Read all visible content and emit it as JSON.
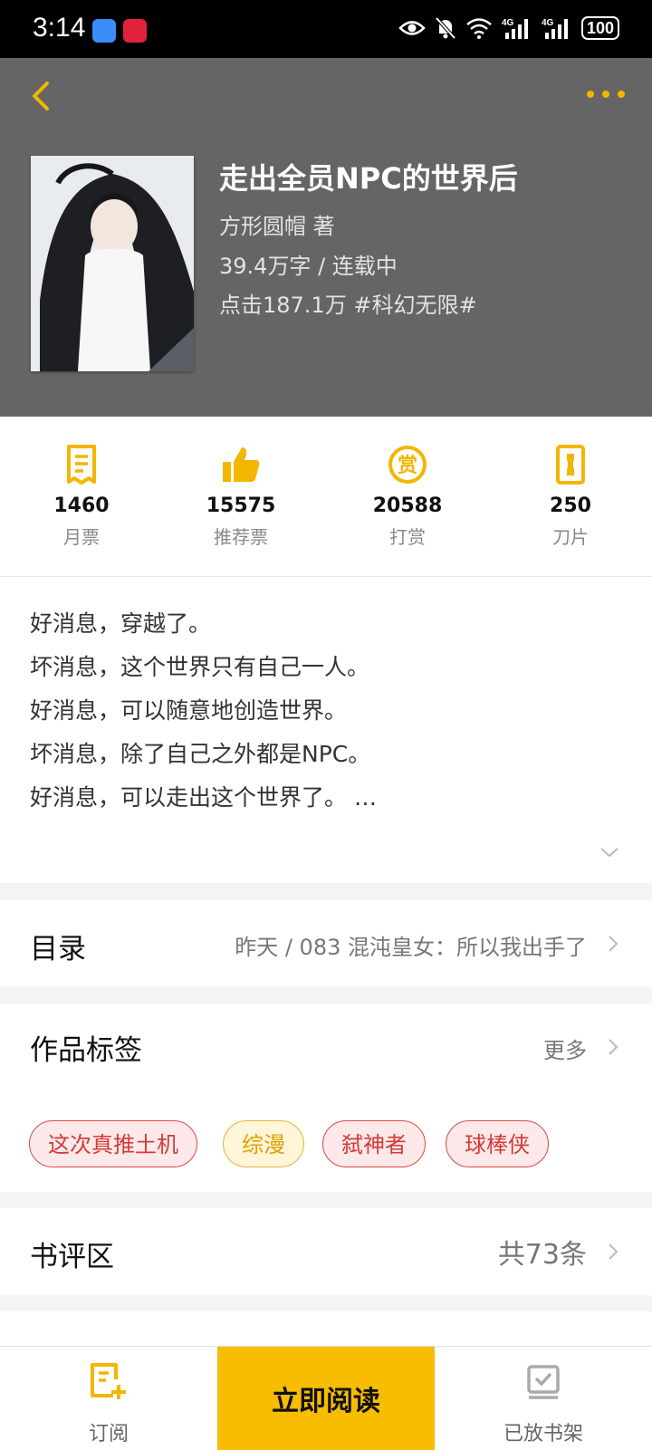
{
  "status_bar": {
    "time": "3:14",
    "battery": "100",
    "network": "4G"
  },
  "book": {
    "title": "走出全员NPC的世界后",
    "author_line": "方形圆帽  著",
    "words_line": "39.4万字 / 连载中",
    "clicks_line": "点击187.1万  #科幻无限#"
  },
  "stats": [
    {
      "value": "1460",
      "label": "月票",
      "icon": "monthly-ticket-icon"
    },
    {
      "value": "15575",
      "label": "推荐票",
      "icon": "thumbs-up-icon"
    },
    {
      "value": "20588",
      "label": "打赏",
      "icon": "reward-coin-icon"
    },
    {
      "value": "250",
      "label": "刀片",
      "icon": "blade-icon"
    }
  ],
  "intro": [
    "好消息，穿越了。",
    "坏消息，这个世界只有自己一人。",
    "好消息，可以随意地创造世界。",
    "坏消息，除了自己之外都是NPC。",
    "好消息，可以走出这个世界了。 …"
  ],
  "catalog": {
    "label": "目录",
    "latest": "昨天 / 083 混沌皇女：所以我出手了"
  },
  "tags_section": {
    "label": "作品标签",
    "more": "更多",
    "tags": [
      "这次真推土机",
      "综漫",
      "弑神者",
      "球棒侠"
    ]
  },
  "reviews": {
    "label": "书评区",
    "count": "共73条"
  },
  "bottom_bar": {
    "subscribe": "订阅",
    "read_now": "立即阅读",
    "on_shelf": "已放书架"
  },
  "colors": {
    "accent": "#f8bc00",
    "header_bg": "#656565",
    "tag_red": "#d43a3a"
  }
}
